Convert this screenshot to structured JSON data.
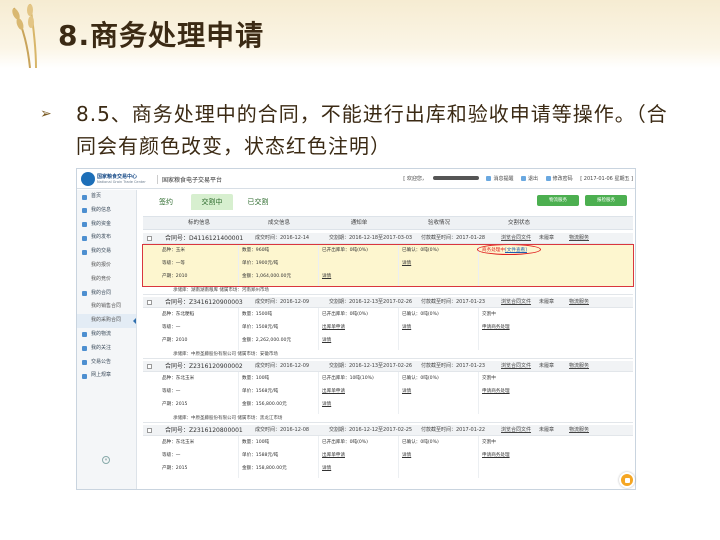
{
  "slide": {
    "title": "8.商务处理申请",
    "bullet": "8.5、商务处理中的合同，不能进行出库和验收申请等操作。（合同会有颜色改变，状态红色注明）"
  },
  "site": {
    "logo_line1": "国家粮食交易中心",
    "logo_line2": "National Grain Trade Center",
    "name": "国家粮食电子交易平台",
    "welcome": "[ 欢迎您，",
    "messages": "消息提醒",
    "logout": "退出",
    "change_password": "修改密码",
    "date": "[ 2017-01-06 星期五 ]"
  },
  "sidebar": {
    "items": [
      {
        "label": "首页"
      },
      {
        "label": "我的信息"
      },
      {
        "label": "我的资金"
      },
      {
        "label": "我的发布"
      },
      {
        "label": "我的交易"
      },
      {
        "label": "我的报价",
        "sub": true
      },
      {
        "label": "我的竞价",
        "sub": true
      },
      {
        "label": "我的合同"
      },
      {
        "label": "我的销售合同",
        "sub": true
      },
      {
        "label": "我的采购合同",
        "sub": true,
        "active": true
      },
      {
        "label": "我的物流"
      },
      {
        "label": "我的关注"
      },
      {
        "label": "交易公告"
      },
      {
        "label": "网上规章"
      }
    ]
  },
  "main": {
    "tabs": [
      "签约",
      "交割中",
      "已交割"
    ],
    "buttons": [
      "物流服务",
      "报检服务"
    ],
    "columns": [
      "标的信息",
      "成交信息",
      "通知单",
      "验收情况",
      "交割状态"
    ]
  },
  "orders": [
    {
      "contract": "合同号：D4116121400001",
      "date": "成交时间：2016-12-14",
      "period": "交割期：2016-12-18至2017-03-03",
      "deadline": "付款截至时间：2017-01-28",
      "view_contract": "浏览合同文件",
      "sign_status": "未履章",
      "logistics": "物流服务",
      "item": "品种：玉米",
      "grade": "等级：一等",
      "year": "产期：2010",
      "qty": "数量：960吨",
      "price": "单价：1900元/吨",
      "amount": "金额：1,064,000.00元",
      "notice_rate": "已开出库单：0吨(0%)",
      "notice_link": "",
      "notice_detail": "详情",
      "accept": "已确认：0吨(0%)",
      "accept_detail": "详情",
      "status_text": "商务处理中",
      "status_link": "[文件查看]",
      "footer": "承储库：湖南湖南粮库    储属市场：河南郑州市场",
      "highlight": true
    },
    {
      "contract": "合同号：Z3416120900003",
      "date": "成交时间：2016-12-09",
      "period": "交割期：2016-12-13至2017-02-26",
      "deadline": "付款截至时间：2017-01-23",
      "view_contract": "浏览合同文件",
      "sign_status": "未履章",
      "logistics": "物流服务",
      "item": "品种：东北粳稻",
      "grade": "等级：一",
      "year": "产期：2010",
      "qty": "数量：1500吨",
      "price": "单价：1508元/吨",
      "amount": "金额：2,262,000.00元",
      "notice_rate": "已开出库单：0吨(0%)",
      "notice_link": "出库单申请",
      "notice_detail": "详情",
      "accept": "已确认：0吨(0%)",
      "accept_detail": "详情",
      "status_text": "交割中",
      "status_link": "申请商务处理",
      "footer": "承储库：中原圣藤股份有限公司    储属市场：安徽市场",
      "highlight": false
    },
    {
      "contract": "合同号：Z2316120900002",
      "date": "成交时间：2016-12-09",
      "period": "交割期：2016-12-13至2017-02-26",
      "deadline": "付款截至时间：2017-01-23",
      "view_contract": "浏览合同文件",
      "sign_status": "未履章",
      "logistics": "物流服务",
      "item": "品种：东北玉米",
      "grade": "等级：一",
      "year": "产期：2015",
      "qty": "数量：100吨",
      "price": "单价：1568元/吨",
      "amount": "金额：156,800.00元",
      "notice_rate": "已开出库单：10吨(10%)",
      "notice_link": "出库单申请",
      "notice_detail": "详情",
      "accept": "已确认：0吨(0%)",
      "accept_detail": "详情",
      "status_text": "交割中",
      "status_link": "申请商务处理",
      "footer": "承储库：中原圣藤股份有限公司    储属市场：黑龙江市场",
      "highlight": false
    },
    {
      "contract": "合同号：Z2316120800001",
      "date": "成交时间：2016-12-08",
      "period": "交割期：2016-12-12至2017-02-25",
      "deadline": "付款截至时间：2017-01-22",
      "view_contract": "浏览合同文件",
      "sign_status": "未履章",
      "logistics": "物流服务",
      "item": "品种：东北玉米",
      "grade": "等级：一",
      "year": "产期：2015",
      "qty": "数量：100吨",
      "price": "单价：1588元/吨",
      "amount": "金额：158,800.00元",
      "notice_rate": "已开出库单：0吨(0%)",
      "notice_link": "出库单申请",
      "notice_detail": "详情",
      "accept": "已确认：0吨(0%)",
      "accept_detail": "详情",
      "status_text": "交割中",
      "status_link": "申请商务处理",
      "footer": "",
      "highlight": false
    }
  ]
}
